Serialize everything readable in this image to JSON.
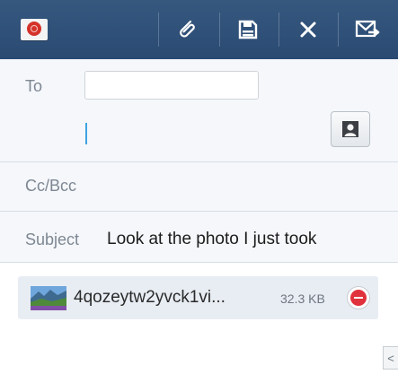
{
  "action_bar": {
    "app_icon": "email-app-icon",
    "buttons": [
      {
        "name": "attach-button",
        "icon": "paperclip-icon"
      },
      {
        "name": "save-draft-button",
        "icon": "save-icon"
      },
      {
        "name": "discard-button",
        "icon": "close-icon"
      },
      {
        "name": "send-button",
        "icon": "send-mail-icon"
      }
    ],
    "color": "#2d4f78"
  },
  "compose": {
    "to_label": "To",
    "to_value": "",
    "contact_icon": "contact-icon",
    "cc_bcc_label": "Cc/Bcc",
    "subject_label": "Subject",
    "subject_value": "Look at the photo I just took"
  },
  "attachment": {
    "thumbnail_icon": "image-thumbnail-icon",
    "file_name": "4qozeytw2yvck1vi...",
    "file_size": "32.3 KB",
    "remove_icon": "remove-icon"
  },
  "edge_handle": {
    "icon": "chevron-left-icon",
    "glyph": "<"
  }
}
